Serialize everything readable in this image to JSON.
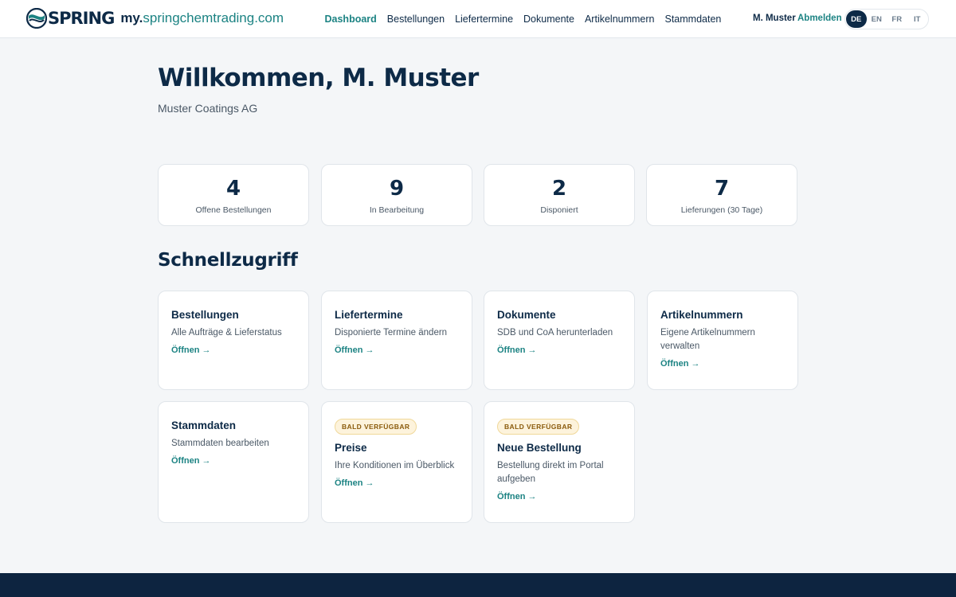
{
  "brand": {
    "logo_icon": "spring-logo-icon",
    "wordmark": "SPRING",
    "domain_prefix": "my.",
    "domain_rest": "springchemtrading.com",
    "colors": {
      "navy": "#0d2a47",
      "teal": "#1c8383"
    }
  },
  "nav": {
    "items": [
      {
        "label": "Dashboard",
        "active": true
      },
      {
        "label": "Bestellungen"
      },
      {
        "label": "Liefertermine"
      },
      {
        "label": "Dokumente"
      },
      {
        "label": "Artikelnummern"
      },
      {
        "label": "Stammdaten"
      }
    ]
  },
  "user": {
    "name": "M. Muster",
    "logout_label": "Abmelden"
  },
  "languages": {
    "items": [
      "DE",
      "EN",
      "FR",
      "IT"
    ],
    "active": "DE"
  },
  "welcome": {
    "title": "Willkommen, M. Muster",
    "company": "Muster Coatings AG"
  },
  "stats": [
    {
      "value": "4",
      "label": "Offene Bestellungen"
    },
    {
      "value": "9",
      "label": "In Bearbeitung"
    },
    {
      "value": "2",
      "label": "Disponiert"
    },
    {
      "value": "7",
      "label": "Lieferungen (30 Tage)"
    }
  ],
  "quick_access": {
    "title": "Schnellzugriff",
    "cards": [
      {
        "badge": "",
        "title": "Bestellungen",
        "desc": "Alle Aufträge & Lieferstatus",
        "link": "Öffnen →"
      },
      {
        "badge": "",
        "title": "Liefertermine",
        "desc": "Disponierte Termine ändern",
        "link": "Öffnen →"
      },
      {
        "badge": "",
        "title": "Dokumente",
        "desc": "SDB und CoA herunterladen",
        "link": "Öffnen →"
      },
      {
        "badge": "",
        "title": "Artikelnummern",
        "desc": "Eigene Artikelnummern verwalten",
        "link": "Öffnen →"
      },
      {
        "badge": "",
        "title": "Stammdaten",
        "desc": "Stammdaten bearbeiten",
        "link": "Öffnen →"
      },
      {
        "badge": "BALD VERFÜGBAR",
        "title": "Preise",
        "desc": "Ihre Konditionen im Überblick",
        "link": "Öffnen →"
      },
      {
        "badge": "BALD VERFÜGBAR",
        "title": "Neue Bestellung",
        "desc": "Bestellung direkt im Portal aufgeben",
        "link": "Öffnen →"
      }
    ]
  }
}
